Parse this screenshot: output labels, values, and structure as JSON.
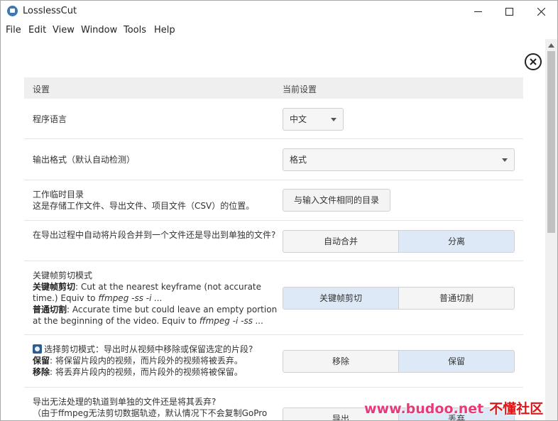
{
  "window": {
    "title": "LosslessCut"
  },
  "menu": [
    "File",
    "Edit",
    "View",
    "Window",
    "Tools",
    "Help"
  ],
  "table": {
    "col_setting": "设置",
    "col_current": "当前设置"
  },
  "settings": {
    "language": {
      "label": "程序语言",
      "value": "中文"
    },
    "output_format": {
      "label": "输出格式（默认自动检测）",
      "value": "格式"
    },
    "working_dir": {
      "label_line1": "工作临时目录",
      "label_line2": "这是存储工作文件、导出文件、项目文件（CSV）的位置。",
      "button": "与输入文件相同的目录"
    },
    "merge_segments": {
      "label": "在导出过程中自动将片段合并到一个文件还是导出到单独的文件?",
      "options": [
        "自动合并",
        "分离"
      ],
      "selected": "分离"
    },
    "keyframe_mode": {
      "title": "关键帧剪切模式",
      "kf_bold": "关键帧剪切",
      "kf_text": ": Cut at the nearest keyframe (not accurate time.) Equiv to ",
      "kf_cmd": "ffmpeg -ss -i ...",
      "normal_bold": "普通切割",
      "normal_text": ": Accurate time but could leave an empty portion at the beginning of the video. Equiv to ",
      "normal_cmd": "ffmpeg -i -ss ...",
      "options": [
        "关键帧剪切",
        "普通切割"
      ],
      "selected": "关键帧剪切"
    },
    "cut_mode": {
      "title": "选择剪切模式：导出时从视频中移除或保留选定的片段?",
      "keep_bold": "保留",
      "keep_text": ": 将保留片段内的视频，而片段外的视频将被丢弃。",
      "remove_bold": "移除",
      "remove_text": ": 将丢弃片段内的视频，而片段外的视频将被保留。",
      "options": [
        "移除",
        "保留"
      ],
      "selected": "保留"
    },
    "unprocessable_tracks": {
      "label_line1": "导出无法处理的轨道到单独的文件还是将其丢弃?",
      "label_line2": "（由于ffmpeg无法剪切数据轨迹，默认情况下不会复制GoPro",
      "options": [
        "导出",
        "丢弃"
      ],
      "selected": "丢弃"
    }
  },
  "watermark": {
    "url": "www.budoo.net",
    "cn": "不懂社区"
  }
}
